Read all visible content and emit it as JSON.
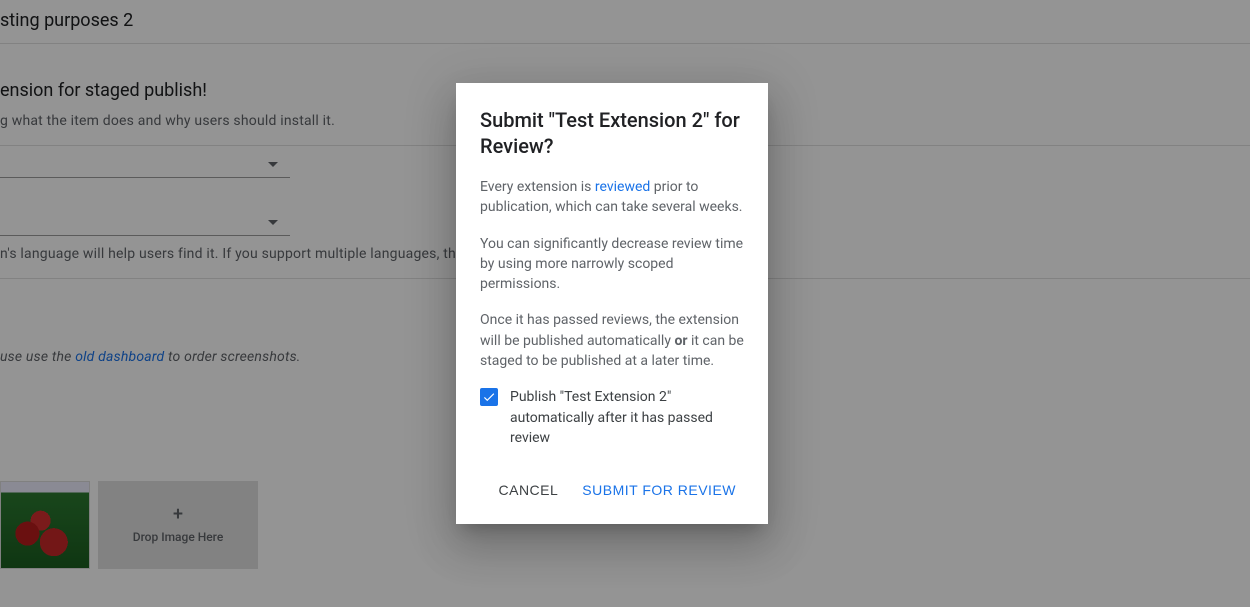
{
  "bg": {
    "title_fragment": "sting purposes 2",
    "heading": "ension for staged publish!",
    "desc_helper": "g what the item does and why users should install it.",
    "lang_helper": "n's language will help users find it. If you support multiple languages, then you sh",
    "screenshots_note_prefix": "use use the ",
    "old_dashboard_link": "old dashboard",
    "screenshots_note_suffix": " to order screenshots.",
    "dropzone_label": "Drop Image Here"
  },
  "dialog": {
    "title": "Submit \"Test Extension 2\" for Review?",
    "p1_prefix": "Every extension is ",
    "reviewed_link": "reviewed",
    "p1_suffix": " prior to publication, which can take several weeks.",
    "p2": "You can significantly decrease review time by using more narrowly scoped permissions.",
    "p3_prefix": "Once it has passed reviews, the extension will be published automatically ",
    "p3_bold": "or",
    "p3_suffix": " it can be staged to be published at a later time.",
    "checkbox_label": "Publish \"Test Extension 2\" automatically after it has passed review",
    "cancel_label": "Cancel",
    "submit_label": "Submit for Review"
  }
}
